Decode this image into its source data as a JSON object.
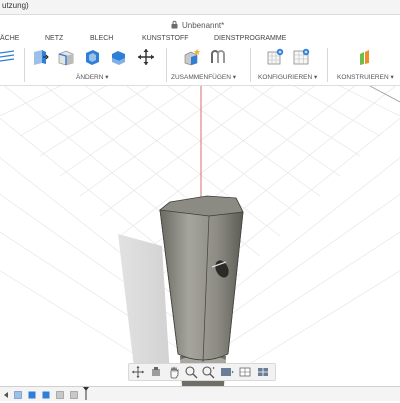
{
  "titlebar": {
    "text": "utzung)"
  },
  "document": {
    "title": "Unbenannt*"
  },
  "tabs": [
    {
      "id": "flache",
      "label": "ÄCHE"
    },
    {
      "id": "netz",
      "label": "NETZ"
    },
    {
      "id": "blech",
      "label": "BLECH"
    },
    {
      "id": "kunststoff",
      "label": "KUNSTSTOFF"
    },
    {
      "id": "dienstprogramme",
      "label": "DIENSTPROGRAMME"
    }
  ],
  "groups": [
    {
      "id": "andern",
      "label": "ÄNDERN ▾"
    },
    {
      "id": "zusammenfugen",
      "label": "ZUSAMMENFÜGEN ▾"
    },
    {
      "id": "konfigurieren",
      "label": "KONFIGURIEREN ▾"
    },
    {
      "id": "konstruieren",
      "label": "KONSTRUIEREN ▾"
    }
  ],
  "colors": {
    "accent": "#2f7fd6",
    "body_fill": "#9b9a92",
    "body_dark": "#5f5e58",
    "grid": "#e4e4e4",
    "axis": "#d24a4a"
  },
  "icons": {
    "sketch_lines": "lines-icon",
    "press_pull": "press-pull-icon",
    "fillet": "fillet-icon",
    "shell": "shell-icon",
    "combine": "combine-icon",
    "move": "move-arrows-icon",
    "new_component": "new-component-icon",
    "joint": "joint-icon",
    "parameters": "parameters-icon",
    "table": "table-icon",
    "offset_plane": "offset-plane-icon"
  },
  "nav": {
    "items": [
      "orbit-icon",
      "pan-icon",
      "hand-icon",
      "zoom-icon",
      "zoom-window-icon",
      "display-icon",
      "grid-icon",
      "viewports-icon"
    ]
  }
}
